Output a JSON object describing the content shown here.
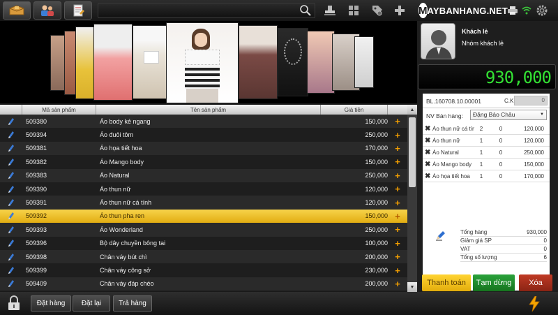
{
  "toolbar": {
    "tabs": [
      {
        "name": "products-tab-icon",
        "active": true
      },
      {
        "name": "customers-tab-icon",
        "active": false
      },
      {
        "name": "orders-tab-icon",
        "active": false
      }
    ],
    "search_placeholder": "",
    "right_icons": [
      "stamp-icon",
      "grid-icon",
      "tag-icon",
      "plus-icon"
    ]
  },
  "brand": {
    "logo_letter": "M",
    "logo_text": "AYBANHANG.NET"
  },
  "status_icons": [
    "printer-icon",
    "wifi-icon",
    "settings-gear-icon"
  ],
  "table": {
    "headers": [
      "Mã sản phẩm",
      "Tên sản phẩm",
      "Giá tiền"
    ],
    "rows": [
      {
        "code": "509380",
        "name": "Áo body kẻ ngang",
        "price": "150,000"
      },
      {
        "code": "509394",
        "name": "Áo đuôi tôm",
        "price": "250,000"
      },
      {
        "code": "509381",
        "name": "Áo họa tiết hoa",
        "price": "170,000"
      },
      {
        "code": "509382",
        "name": "Áo Mango body",
        "price": "150,000"
      },
      {
        "code": "509383",
        "name": "Áo Natural",
        "price": "250,000"
      },
      {
        "code": "509390",
        "name": "Áo thun nữ",
        "price": "120,000"
      },
      {
        "code": "509391",
        "name": "Áo thun nữ cá tính",
        "price": "120,000"
      },
      {
        "code": "509392",
        "name": "Áo thun pha ren",
        "price": "150,000"
      },
      {
        "code": "509393",
        "name": "Áo Wonderland",
        "price": "250,000"
      },
      {
        "code": "509396",
        "name": "Bộ dây chuyền bông tai",
        "price": "100,000"
      },
      {
        "code": "509398",
        "name": "Chân váy bút chì",
        "price": "200,000"
      },
      {
        "code": "509399",
        "name": "Chân váy công sở",
        "price": "230,000"
      },
      {
        "code": "509409",
        "name": "Chân váy đáp chéo",
        "price": "200,000"
      }
    ],
    "selected_index": 7
  },
  "bottom": {
    "dat_hang": "Đặt hàng",
    "dat_lai": "Đặt lại",
    "tra_hang": "Trả hàng"
  },
  "customer": {
    "name": "Khách lẻ",
    "group": "Nhóm khách lẻ"
  },
  "total_display": "930,000",
  "order": {
    "bill_code": "BL.160708.10.00001",
    "ck_label": "C.K",
    "ck_value": "0",
    "staff_label": "NV Bán hàng:",
    "staff_value": "Đặng Bảo Châu",
    "items": [
      {
        "name": "Áo thun nữ cá tính",
        "qty": "2",
        "discount": "0",
        "amount": "120,000"
      },
      {
        "name": "Áo thun nữ",
        "qty": "1",
        "discount": "0",
        "amount": "120,000"
      },
      {
        "name": "Áo Natural",
        "qty": "1",
        "discount": "0",
        "amount": "250,000"
      },
      {
        "name": "Áo Mango body",
        "qty": "1",
        "discount": "0",
        "amount": "150,000"
      },
      {
        "name": "Áo họa tiết hoa",
        "qty": "1",
        "discount": "0",
        "amount": "170,000"
      }
    ],
    "summary": [
      {
        "label": "Tổng hàng",
        "value": "930,000"
      },
      {
        "label": "Giảm giá SP",
        "value": "0"
      },
      {
        "label": "VAT",
        "value": "0"
      },
      {
        "label": "Tổng số lượng",
        "value": "6"
      }
    ]
  },
  "actions": {
    "pay": "Thanh toán",
    "pause": "Tạm dừng",
    "delete": "Xóa"
  },
  "colors": {
    "accent_yellow": "#f0c020",
    "pay_bg": "#f2c21a",
    "pause_bg": "#1f8a2e",
    "delete_bg": "#a3301c",
    "total_green": "#33e033",
    "add_orange": "#f5a000"
  }
}
